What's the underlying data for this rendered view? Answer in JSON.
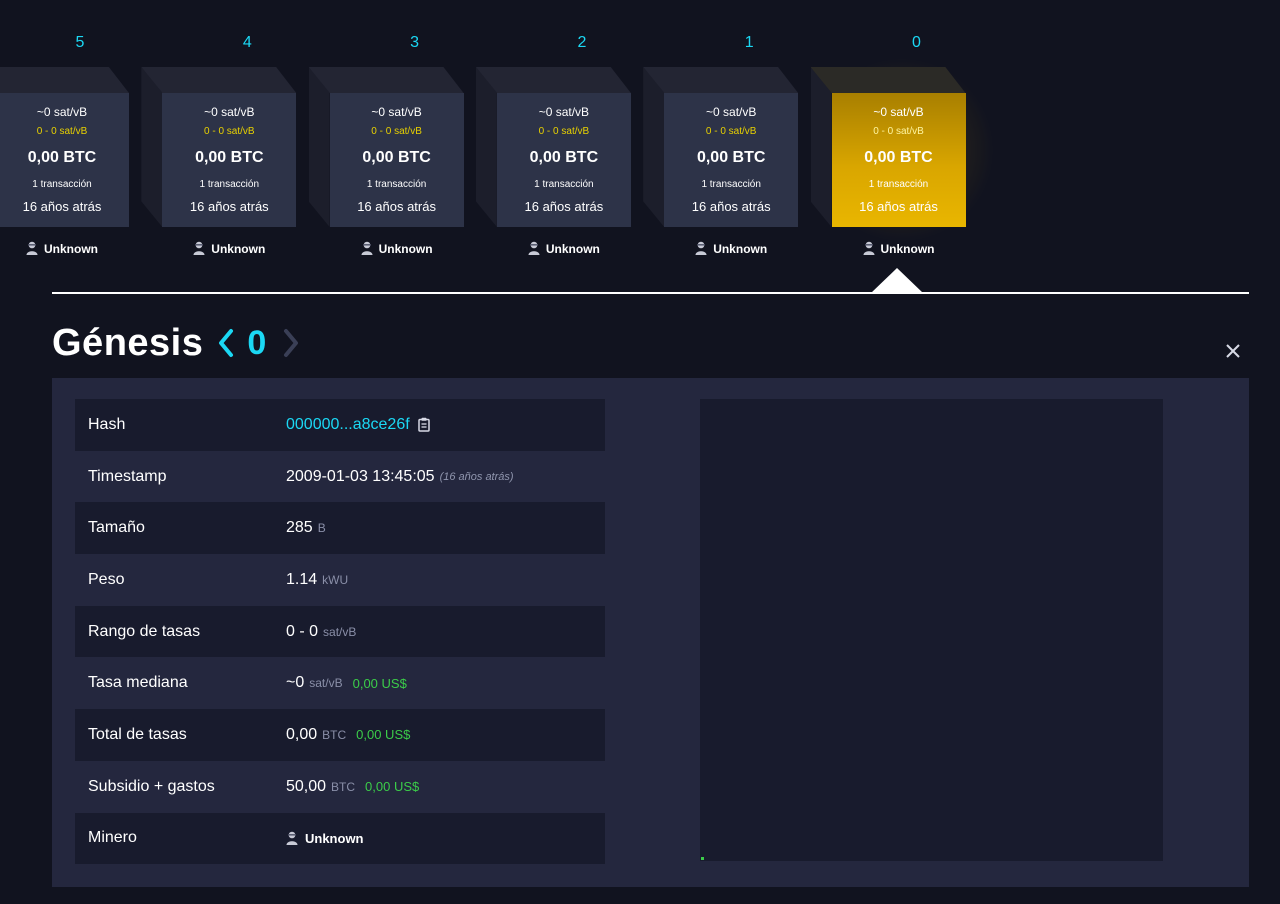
{
  "blocks": [
    {
      "height": "5",
      "median_fee": "~0 sat/vB",
      "fee_range": "0 - 0 sat/vB",
      "amount": "0,00 BTC",
      "tx_count": "1 transacción",
      "time_ago": "16 años atrás",
      "miner": "Unknown",
      "selected": false
    },
    {
      "height": "4",
      "median_fee": "~0 sat/vB",
      "fee_range": "0 - 0 sat/vB",
      "amount": "0,00 BTC",
      "tx_count": "1 transacción",
      "time_ago": "16 años atrás",
      "miner": "Unknown",
      "selected": false
    },
    {
      "height": "3",
      "median_fee": "~0 sat/vB",
      "fee_range": "0 - 0 sat/vB",
      "amount": "0,00 BTC",
      "tx_count": "1 transacción",
      "time_ago": "16 años atrás",
      "miner": "Unknown",
      "selected": false
    },
    {
      "height": "2",
      "median_fee": "~0 sat/vB",
      "fee_range": "0 - 0 sat/vB",
      "amount": "0,00 BTC",
      "tx_count": "1 transacción",
      "time_ago": "16 años atrás",
      "miner": "Unknown",
      "selected": false
    },
    {
      "height": "1",
      "median_fee": "~0 sat/vB",
      "fee_range": "0 - 0 sat/vB",
      "amount": "0,00 BTC",
      "tx_count": "1 transacción",
      "time_ago": "16 años atrás",
      "miner": "Unknown",
      "selected": false
    },
    {
      "height": "0",
      "median_fee": "~0 sat/vB",
      "fee_range": "0 - 0 sat/vB",
      "amount": "0,00 BTC",
      "tx_count": "1 transacción",
      "time_ago": "16 años atrás",
      "miner": "Unknown",
      "selected": true
    }
  ],
  "header": {
    "title": "Génesis",
    "block_number": "0"
  },
  "details": {
    "hash": {
      "label": "Hash",
      "value": "000000...a8ce26f"
    },
    "timestamp": {
      "label": "Timestamp",
      "value": "2009-01-03 13:45:05",
      "relative": "(16 años atrás)"
    },
    "size": {
      "label": "Tamaño",
      "value": "285",
      "unit": "B"
    },
    "weight": {
      "label": "Peso",
      "value": "1.14",
      "unit": "kWU"
    },
    "fee_range": {
      "label": "Rango de tasas",
      "value": "0 - 0",
      "unit": "sat/vB"
    },
    "median_fee": {
      "label": "Tasa mediana",
      "value": "~0",
      "unit": "sat/vB",
      "fiat": "0,00 US$"
    },
    "total_fees": {
      "label": "Total de tasas",
      "value": "0,00",
      "unit": "BTC",
      "fiat": "0,00 US$"
    },
    "subsidy_fees": {
      "label": "Subsidio + gastos",
      "value": "50,00",
      "unit": "BTC",
      "fiat": "0,00 US$"
    },
    "miner": {
      "label": "Minero",
      "value": "Unknown"
    }
  },
  "icons": {
    "miner": "user-icon",
    "copy": "clipboard-icon",
    "prev": "chevron-left-icon",
    "next": "chevron-right-icon",
    "close": "close-icon"
  },
  "colors": {
    "accent": "#1bd8f4",
    "selected_block": "#e0ad00",
    "fee_range": "#e8d100",
    "fiat": "#3bcc49",
    "background": "#11131f",
    "panel": "#24273e"
  }
}
